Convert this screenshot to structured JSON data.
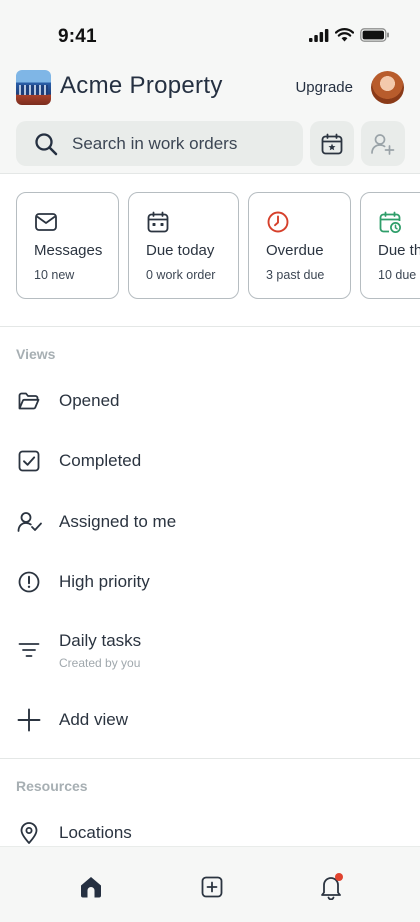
{
  "status_bar": {
    "time": "9:41"
  },
  "header": {
    "app_title": "Acme Property",
    "upgrade_label": "Upgrade"
  },
  "search": {
    "placeholder": "Search in work orders"
  },
  "cards": [
    {
      "title": "Messages",
      "subtitle": "10 new",
      "icon": "envelope-icon",
      "color": "#2b3440"
    },
    {
      "title": "Due today",
      "subtitle": "0 work order",
      "icon": "calendar-icon",
      "color": "#2b3440"
    },
    {
      "title": "Overdue",
      "subtitle": "3 past due",
      "icon": "clock-icon",
      "color": "#d6402b"
    },
    {
      "title": "Due th",
      "subtitle": "10 due",
      "icon": "calendar-clock-icon",
      "color": "#2f9e6a"
    }
  ],
  "views": {
    "heading": "Views",
    "items": [
      {
        "label": "Opened",
        "icon": "folder-open-icon"
      },
      {
        "label": "Completed",
        "icon": "checkbox-icon"
      },
      {
        "label": "Assigned to me",
        "icon": "user-check-icon"
      },
      {
        "label": "High priority",
        "icon": "alert-circle-icon"
      },
      {
        "label": "Daily tasks",
        "sublabel": "Created by you",
        "icon": "filter-lines-icon"
      },
      {
        "label": "Add view",
        "icon": "plus-icon"
      }
    ]
  },
  "resources": {
    "heading": "Resources",
    "items": [
      {
        "label": "Locations",
        "icon": "map-pin-icon"
      }
    ]
  },
  "bottom_nav": {
    "items": [
      "home-icon",
      "add-square-icon",
      "bell-icon"
    ],
    "notification_dot_color": "#e0432f"
  }
}
